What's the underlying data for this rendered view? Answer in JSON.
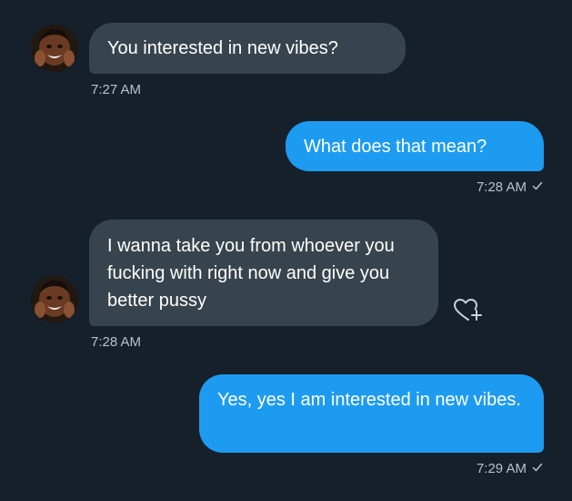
{
  "messages": [
    {
      "direction": "incoming",
      "text": "You interested in new vibes?",
      "time": "7:27 AM"
    },
    {
      "direction": "outgoing",
      "text": "What does that mean?",
      "time": "7:28 AM",
      "status_icon": "check-icon"
    },
    {
      "direction": "incoming",
      "text": "I wanna take you from whoever you fucking with right now and give you better pussy",
      "time": "7:28 AM",
      "action_icon": "add-reaction-icon"
    },
    {
      "direction": "outgoing",
      "text": "Yes, yes I am interested in new vibes.",
      "time": "7:29 AM",
      "status_icon": "check-icon"
    }
  ],
  "colors": {
    "background": "#15202b",
    "incoming_bubble": "#38444d",
    "outgoing_bubble": "#1d9bf0",
    "timestamp": "#b9c2ca"
  }
}
